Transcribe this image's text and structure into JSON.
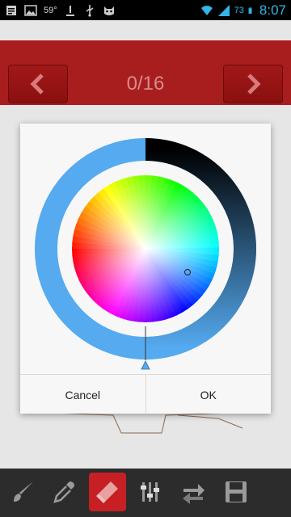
{
  "status_bar": {
    "temperature": "59°",
    "battery_percent": "73",
    "time": "8:07",
    "icons": [
      "notes-icon",
      "gallery-icon",
      "download-icon",
      "usb-icon",
      "cat-icon",
      "wifi-icon",
      "signal-icon",
      "battery-icon"
    ]
  },
  "header": {
    "page_counter": "0/16",
    "prev_icon": "chevron-left-icon",
    "next_icon": "chevron-right-icon"
  },
  "color_dialog": {
    "cancel_label": "Cancel",
    "ok_label": "OK",
    "selected_color": "#55aaf0",
    "ring_colors": [
      "#000000",
      "#55aaf0"
    ],
    "selector_marker": "circle"
  },
  "toolbar": {
    "tools": [
      {
        "name": "brush-tool",
        "icon": "brush-icon",
        "active": false
      },
      {
        "name": "eyedropper-tool",
        "icon": "eyedropper-icon",
        "active": false
      },
      {
        "name": "eraser-tool",
        "icon": "eraser-icon",
        "active": true
      },
      {
        "name": "adjust-tool",
        "icon": "sliders-icon",
        "active": false
      },
      {
        "name": "swap-tool",
        "icon": "swap-icon",
        "active": false
      },
      {
        "name": "save-tool",
        "icon": "save-icon",
        "active": false
      }
    ],
    "accent_color": "#c61f24"
  }
}
